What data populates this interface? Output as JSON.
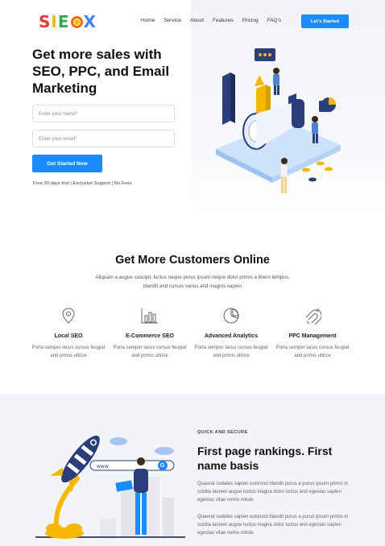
{
  "header": {
    "logo": "SIEOX",
    "nav": [
      "Home",
      "Service",
      "About",
      "Features",
      "Pricing",
      "FAQ's"
    ],
    "cta": "Let's Started"
  },
  "hero": {
    "title": "Get more sales with SEO, PPC, and Email Marketing",
    "name_placeholder": "Enter your name*",
    "email_placeholder": "Enter your email*",
    "button": "Get Started Now",
    "note": "Free 30 days trial | Exclusive Support | No Fees"
  },
  "customers": {
    "title": "Get More Customers Online",
    "description": "Aliquam a augue suscipit, luctus neque purus ipsum neque dolor primis a libero tempus, blandit and cursus varius and magnis sapien",
    "services": [
      {
        "icon": "location-pin-icon",
        "name": "Local SEO",
        "desc": "Porta semper lacus cursus feugiat and primis ultrice"
      },
      {
        "icon": "bar-chart-icon",
        "name": "E-Commerce SEO",
        "desc": "Porta semper lacus cursus feugiat and primis ultrice"
      },
      {
        "icon": "pie-chart-icon",
        "name": "Advanced Analytics",
        "desc": "Porta semper lacus cursus feugiat and primis ultrice"
      },
      {
        "icon": "magnet-icon",
        "name": "PPC Management",
        "desc": "Porta semper lacus cursus feugiat and primis ultrice"
      }
    ]
  },
  "rankings": {
    "kicker": "QUICK AND SECURE",
    "title": "First page rankings. First name basis",
    "paragraphs": [
      "Quaerat sodales sapien euismod blandit purus a purus ipsum primis in cubilia laoreet augue luctus magna dolor luctus and egestas sapien egestas vitae nemo volute",
      "Quaerat sodales sapien euismod blandit purus a purus ipsum primis in cubilia laoreet augue luctus magna dolor luctus and egestas sapien egestas vitae nemo volute"
    ],
    "search_text": "www"
  },
  "colors": {
    "accent": "#1a8cff",
    "navy": "#2c3e7a",
    "rocket_flame": "#f5b700"
  }
}
